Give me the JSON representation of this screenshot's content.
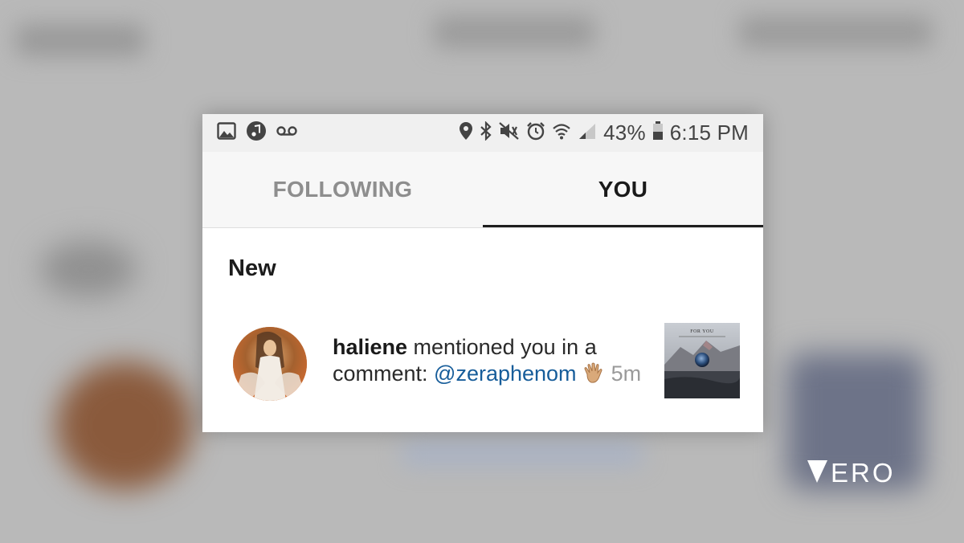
{
  "status_bar": {
    "left_icons": [
      "image-icon",
      "music-icon",
      "voicemail-icon"
    ],
    "right_icons": [
      "location-icon",
      "bluetooth-icon",
      "mute-icon",
      "alarm-icon",
      "wifi-icon",
      "signal-icon",
      "battery-icon"
    ],
    "battery": "43%",
    "time": "6:15 PM"
  },
  "tabs": [
    {
      "label": "FOLLOWING",
      "active": false
    },
    {
      "label": "YOU",
      "active": true
    }
  ],
  "section": {
    "title": "New"
  },
  "notification": {
    "username": "haliene",
    "text_part1": " mentioned you in a comment: ",
    "mention": "@zeraphenom",
    "emoji": "waving-hand-icon",
    "time": "5m"
  },
  "thumbnail": {
    "text": "FOR YOU"
  },
  "brand": {
    "logo_text": "VERO"
  },
  "colors": {
    "mention": "#175d9a",
    "active_tab_underline": "#1e1e1e",
    "background": "#b9b9b9"
  }
}
